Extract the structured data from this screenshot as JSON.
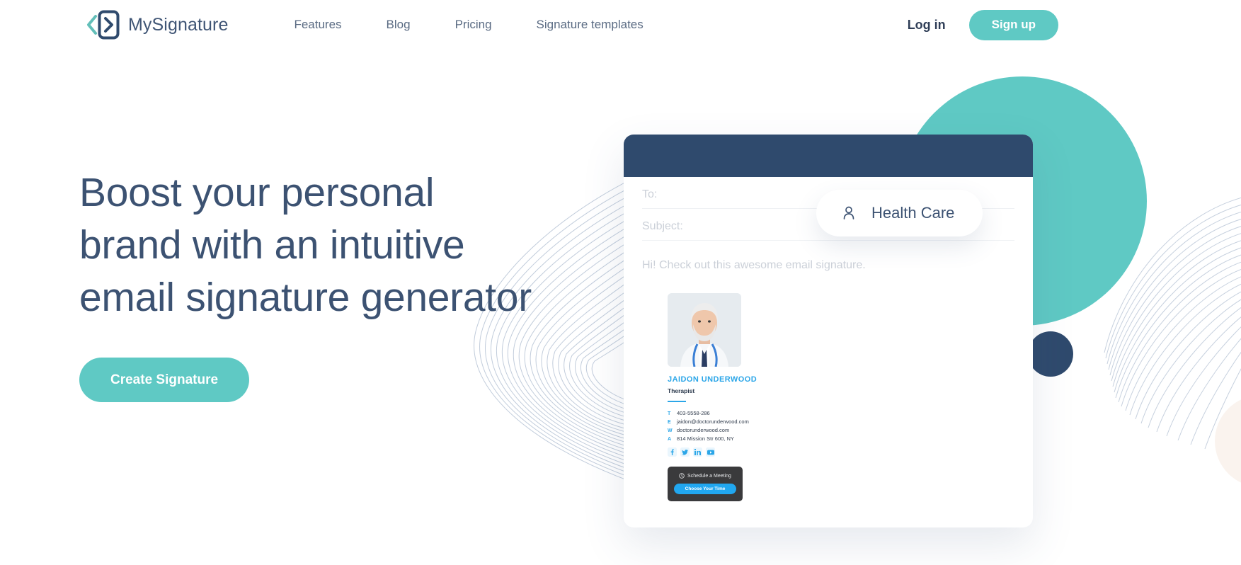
{
  "header": {
    "brand": {
      "name": "MySignature",
      "mark_icon": "chevron-logo-icon"
    },
    "nav": [
      {
        "label": "Features"
      },
      {
        "label": "Blog"
      },
      {
        "label": "Pricing"
      },
      {
        "label": "Signature templates"
      }
    ],
    "login_label": "Log in",
    "signup_label": "Sign up"
  },
  "hero": {
    "title": "Boost your personal brand with an intuitive email signature generator",
    "cta_label": "Create Signature"
  },
  "mail": {
    "to_label": "To:",
    "subject_label": "Subject:",
    "greeting": "Hi! Check out this awesome email signature."
  },
  "badge": {
    "icon": "person-icon",
    "label": "Health Care"
  },
  "signature": {
    "photo_alt": "doctor-portrait",
    "name": "JAIDON UNDERWOOD",
    "role": "Therapist",
    "contacts": [
      {
        "key": "T",
        "value": "403-5558-286"
      },
      {
        "key": "E",
        "value": "jaidon@doctorunderwood.com"
      },
      {
        "key": "W",
        "value": "doctorunderwood.com"
      },
      {
        "key": "A",
        "value": "814 Mission Str 600, NY"
      }
    ],
    "social": [
      {
        "icon": "facebook-icon",
        "glyph": "f"
      },
      {
        "icon": "twitter-icon",
        "glyph": "t"
      },
      {
        "icon": "linkedin-icon",
        "glyph": "in"
      },
      {
        "icon": "youtube-icon",
        "glyph": "y"
      }
    ],
    "banner": {
      "icon": "clock-icon",
      "text": "Schedule a Meeting",
      "button_label": "Choose Your Time"
    }
  },
  "colors": {
    "teal": "#5FC9C4",
    "navy": "#2F4A6D",
    "heading": "#3C5272",
    "accent_blue": "#2BA6E8",
    "banner_dark": "#3A3A3C",
    "cream": "#FAF3EE"
  }
}
